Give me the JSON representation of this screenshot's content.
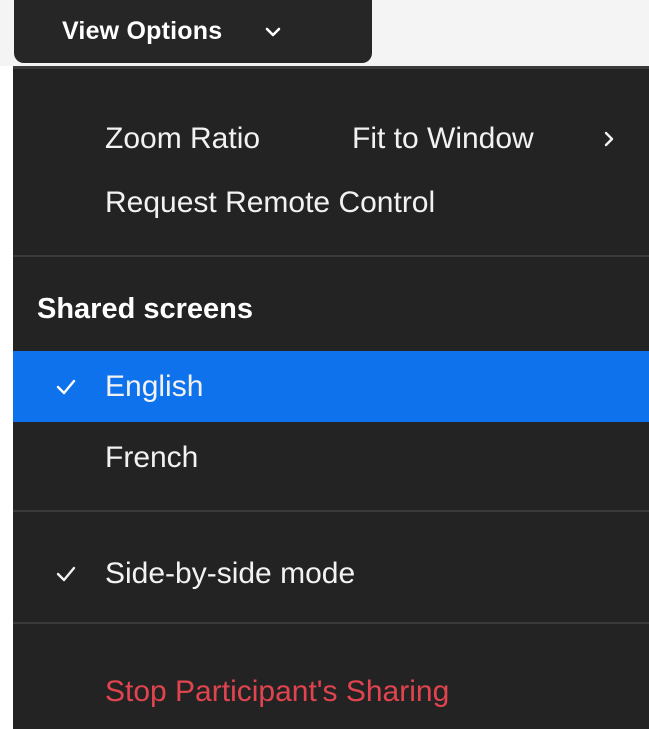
{
  "toolbar": {
    "view_options_label": "View Options",
    "chevron_icon": "chevron-down-icon"
  },
  "menu": {
    "zoom_ratio_label": "Zoom Ratio",
    "zoom_ratio_value": "Fit to Window",
    "request_remote_control": "Request Remote Control",
    "shared_screens_heading": "Shared screens",
    "screens": [
      {
        "label": "English",
        "checked": true,
        "highlighted": true
      },
      {
        "label": "French",
        "checked": false,
        "highlighted": false
      }
    ],
    "side_by_side_label": "Side-by-side mode",
    "side_by_side_checked": true,
    "stop_sharing_label": "Stop Participant's Sharing"
  },
  "colors": {
    "menu_background": "#232323",
    "highlight": "#0e72ed",
    "danger_text": "#e0444e",
    "text": "#f2f2f2"
  }
}
